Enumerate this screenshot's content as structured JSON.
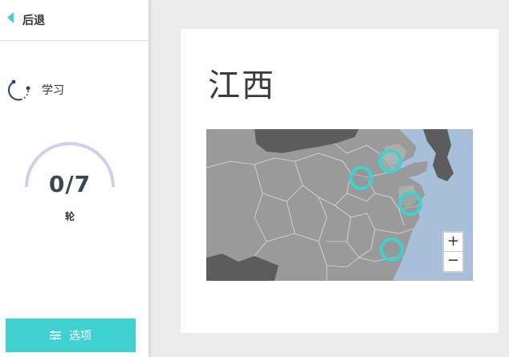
{
  "sidebar": {
    "back_label": "后退",
    "mode_label": "学习",
    "progress": {
      "count": "0/7",
      "unit": "轮",
      "fraction": 0
    },
    "options_label": "选项"
  },
  "card": {
    "title": "江西"
  },
  "map": {
    "zoom_in": "+",
    "zoom_out": "−",
    "marker_count": 4
  },
  "colors": {
    "accent": "#3fd1cf",
    "arc": "#ccd1ed",
    "water": "#a7bfd9",
    "land": "#9a9a9a",
    "foreign_land": "#5c5c5c",
    "highlight": "#bdbdbd"
  },
  "icons": {
    "back": "triangle-left-icon",
    "mode": "learn-cycle-icon",
    "options": "sliders-icon"
  }
}
